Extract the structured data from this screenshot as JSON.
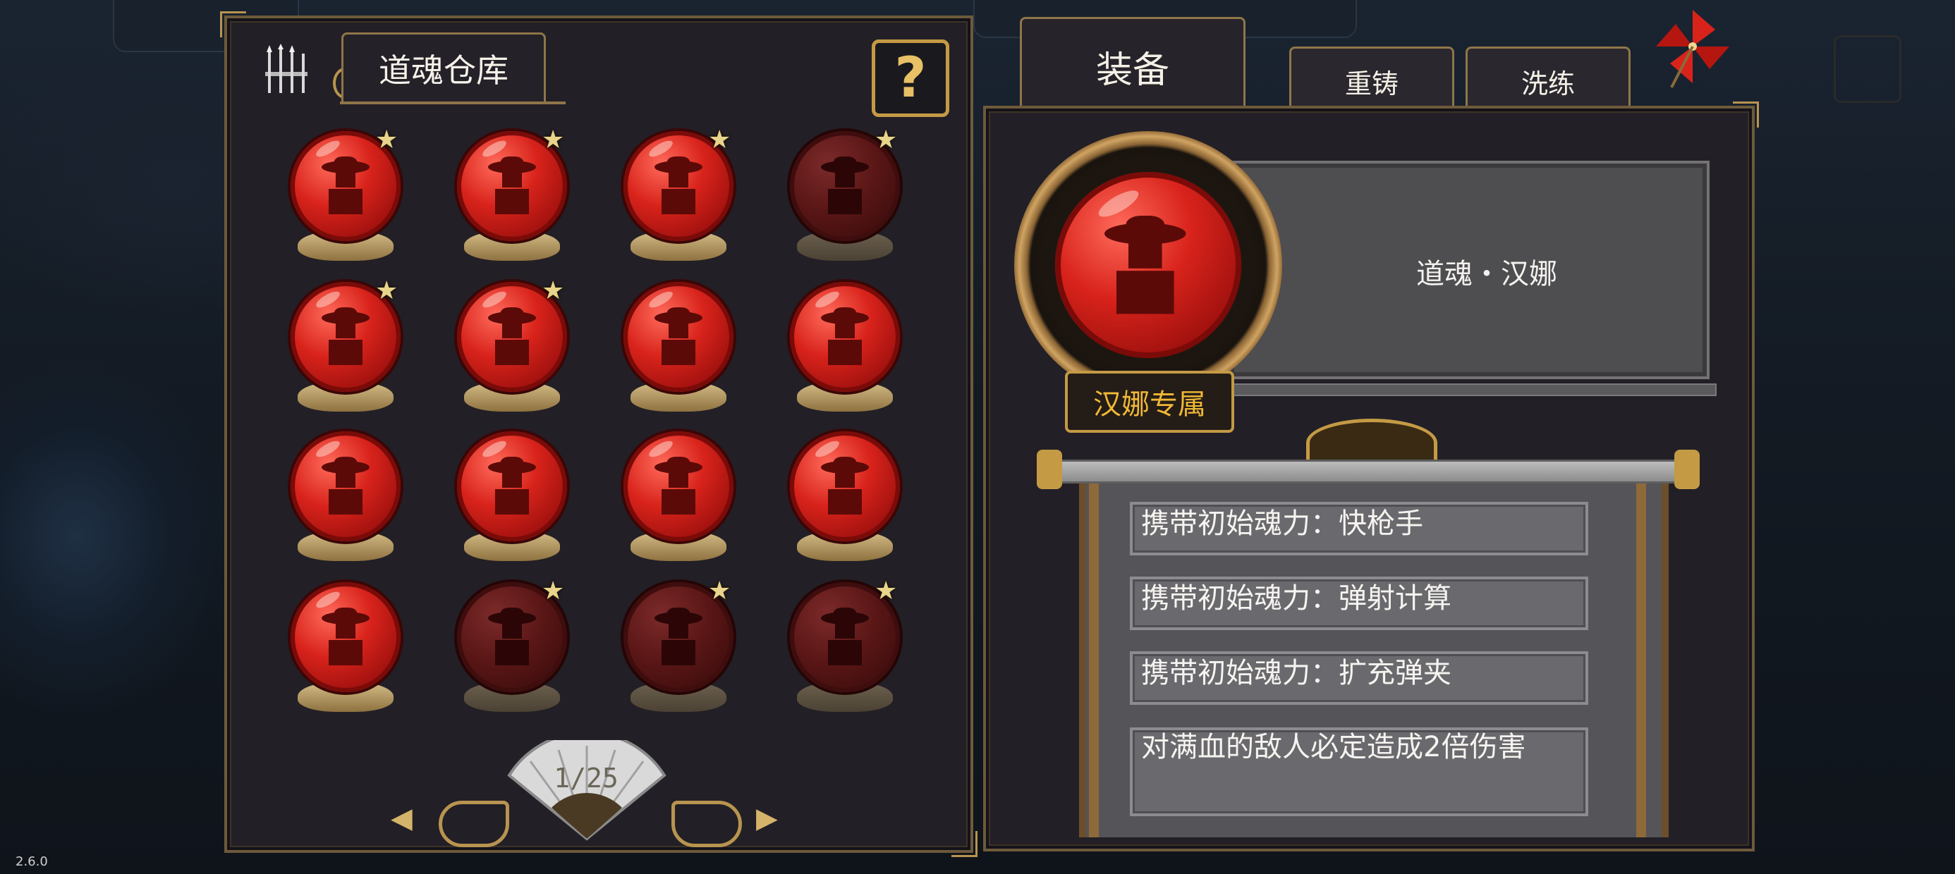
{
  "version": "2.6.0",
  "warehouse": {
    "title": "道魂仓库",
    "help_label": "?",
    "slots": [
      {
        "owned": true,
        "star": true
      },
      {
        "owned": true,
        "star": true
      },
      {
        "owned": true,
        "star": true
      },
      {
        "owned": false,
        "star": true
      },
      {
        "owned": true,
        "star": true
      },
      {
        "owned": true,
        "star": true
      },
      {
        "owned": true,
        "star": false
      },
      {
        "owned": true,
        "star": false
      },
      {
        "owned": true,
        "star": false
      },
      {
        "owned": true,
        "star": false
      },
      {
        "owned": true,
        "star": false
      },
      {
        "owned": true,
        "star": false
      },
      {
        "owned": true,
        "star": false
      },
      {
        "owned": false,
        "star": true
      },
      {
        "owned": false,
        "star": true
      },
      {
        "owned": false,
        "star": true
      }
    ],
    "star_glyph": "★",
    "pager": {
      "page": "1/25",
      "prev": "◀",
      "next": "▶"
    }
  },
  "tabs": {
    "equip": "装备",
    "recast": "重铸",
    "refine": "洗练"
  },
  "detail": {
    "name": "道魂・汉娜",
    "exclusive": "汉娜专属",
    "attributes": [
      "携带初始魂力：快枪手",
      "携带初始魂力：弹射计算",
      "携带初始魂力：扩充弹夹",
      "对满血的敌人必定造成2倍伤害"
    ]
  },
  "colors": {
    "accent_gold": "#c49a45",
    "orb_red": "#d8231b",
    "exclusive_text": "#f0b836"
  }
}
